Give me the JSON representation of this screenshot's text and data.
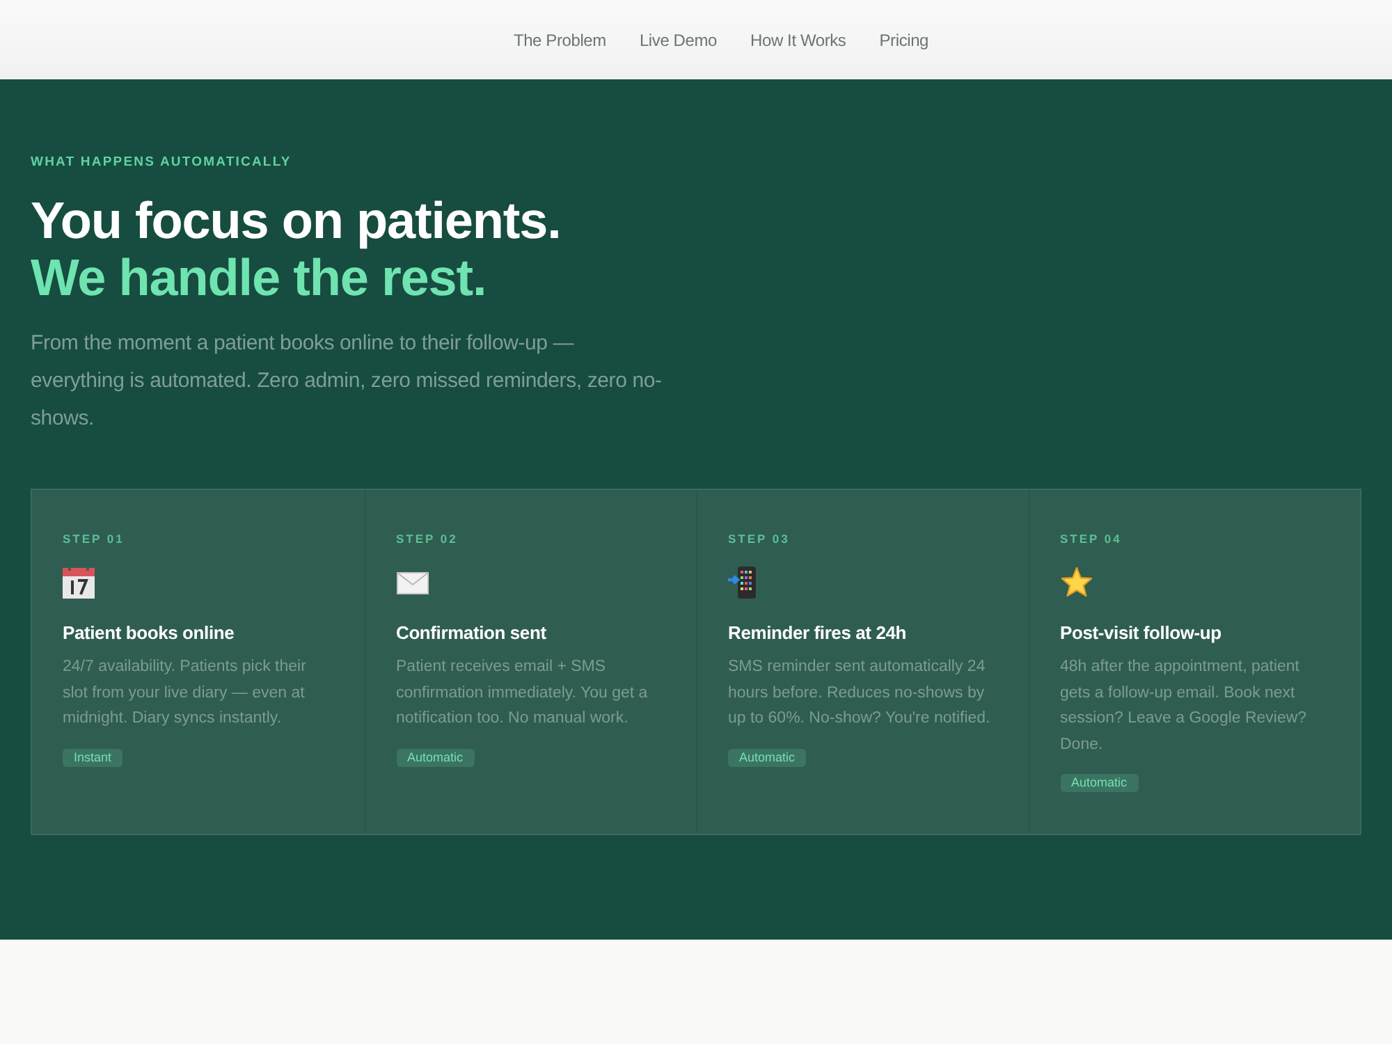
{
  "nav": {
    "links": [
      "The Problem",
      "Live Demo",
      "How It Works",
      "Pricing"
    ]
  },
  "hero": {
    "eyebrow": "WHAT HAPPENS AUTOMATICALLY",
    "headline": "You focus on patients.",
    "headline_accent": "We handle the rest.",
    "description": "From the moment a patient books online to their follow-up — everything is automated. Zero admin, zero missed reminders, zero no-shows."
  },
  "steps": [
    {
      "label": "STEP 01",
      "kind": "calendar",
      "title": "Patient books online",
      "description": "24/7 availability. Patients pick their slot from your live diary — even at midnight. Diary syncs instantly.",
      "badge": "Instant"
    },
    {
      "label": "STEP 02",
      "kind": "envelope",
      "title": "Confirmation sent",
      "description": "Patient receives email + SMS confirmation immediately. You get a notification too. No manual work.",
      "badge": "Automatic"
    },
    {
      "label": "STEP 03",
      "kind": "phone",
      "title": "Reminder fires at 24h",
      "description": "SMS reminder sent automatically 24 hours before. Reduces no-shows by up to 60%. No-show? You're notified.",
      "badge": "Automatic"
    },
    {
      "label": "STEP 04",
      "kind": "star",
      "title": "Post-visit follow-up",
      "description": "48h after the appointment, patient gets a follow-up email. Book next session? Leave a Google Review? Done.",
      "badge": "Automatic"
    }
  ]
}
